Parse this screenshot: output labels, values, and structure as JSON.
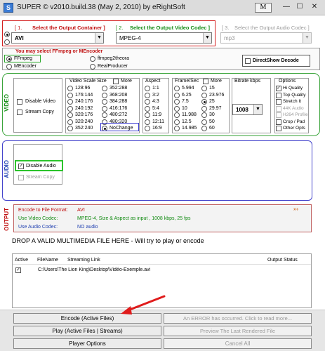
{
  "window": {
    "title": "SUPER © v2010.build.38 (May 2, 2010) by eRightSoft",
    "m_button": "M",
    "minimize": "—",
    "maximize": "☐",
    "close": "✕"
  },
  "output_container": {
    "number": "[ 1.",
    "label": "Select the Output Container ]",
    "value": "AVI"
  },
  "video_codec": {
    "number": "[ 2.",
    "label": "Select the Output Video Codec ]",
    "value": "MPEG-4"
  },
  "audio_codec": {
    "number": "[ 3.",
    "label": "Select the Output Audio Codec ]",
    "value": "mp3"
  },
  "encoder": {
    "prompt": "You may select FFmpeg or MEncoder",
    "options": [
      "FFmpeg",
      "MEncoder",
      "ffmpeg2theora",
      "RealProducer"
    ],
    "selected": "FFmpeg",
    "directshow_label": "DirectShow Decode"
  },
  "video": {
    "section_label": "VIDEO",
    "disable_video": "Disable Video",
    "stream_copy": "Stream Copy",
    "scale": {
      "title": "Video Scale Size",
      "more": "More",
      "col1": [
        "128:96",
        "176:144",
        "240:176",
        "240:192",
        "320:176",
        "320:240",
        "352:240"
      ],
      "col2": [
        "352:288",
        "368:208",
        "384:288",
        "416:176",
        "480:272",
        "480:320",
        "NoChange"
      ],
      "selected": "NoChange"
    },
    "aspect": {
      "title": "Aspect",
      "values": [
        "1:1",
        "3:2",
        "4:3",
        "5:4",
        "11:9",
        "12:11",
        "16:9"
      ]
    },
    "fps": {
      "title": "Frame/Sec",
      "more": "More",
      "col1": [
        "5.994",
        "6.25",
        "7.5",
        "10",
        "11.988",
        "12.5",
        "14.985"
      ],
      "col2": [
        "15",
        "23.976",
        "25",
        "29.97",
        "30",
        "50",
        "60"
      ],
      "selected": "25"
    },
    "bitrate": {
      "title": "Bitrate  kbps",
      "value": "1008"
    },
    "options": {
      "title": "Options",
      "items": [
        {
          "label": "Hi Quality",
          "checked": true,
          "enabled": true
        },
        {
          "label": "Top Quality",
          "checked": false,
          "enabled": true
        },
        {
          "label": "Stretch It",
          "checked": false,
          "enabled": true
        },
        {
          "label": "44K Audio",
          "checked": false,
          "enabled": false
        },
        {
          "label": "H264 Profile",
          "checked": false,
          "enabled": false
        },
        {
          "label": "Crop / Pad",
          "checked": false,
          "enabled": true
        },
        {
          "label": "Other Opts",
          "checked": false,
          "enabled": true
        }
      ]
    }
  },
  "audio": {
    "section_label": "AUDIO",
    "disable_audio": "Disable Audio",
    "stream_copy": "Stream Copy"
  },
  "output": {
    "section_label": "OUTPUT",
    "rows": [
      {
        "key": "Encode to File Format:",
        "value": "AVI"
      },
      {
        "key": "Use Video Codec:",
        "value": "MPEG-4,  Size & Aspect as input ,  1008 kbps,  25 fps"
      },
      {
        "key": "Use Audio Codec:",
        "value": "NO audio"
      }
    ],
    "more": "›››"
  },
  "drop_text": "DROP A VALID MULTIMEDIA FILE HERE - Will try to play or encode",
  "files": {
    "headers": [
      "Active",
      "FileName",
      "Streaming Link",
      "Output Status"
    ],
    "rows": [
      {
        "active": true,
        "path": "C:\\Users\\The Lion King\\Desktop\\Vidéo-Exemple.avi"
      }
    ]
  },
  "buttons": {
    "encode": "Encode (Active Files)",
    "play": "Play (Active Files | Streams)",
    "player_options": "Player Options",
    "error": "An ERROR has occurred. Click to read more...",
    "preview": "Preview The Last Rendered File",
    "cancel": "Cancel All"
  }
}
